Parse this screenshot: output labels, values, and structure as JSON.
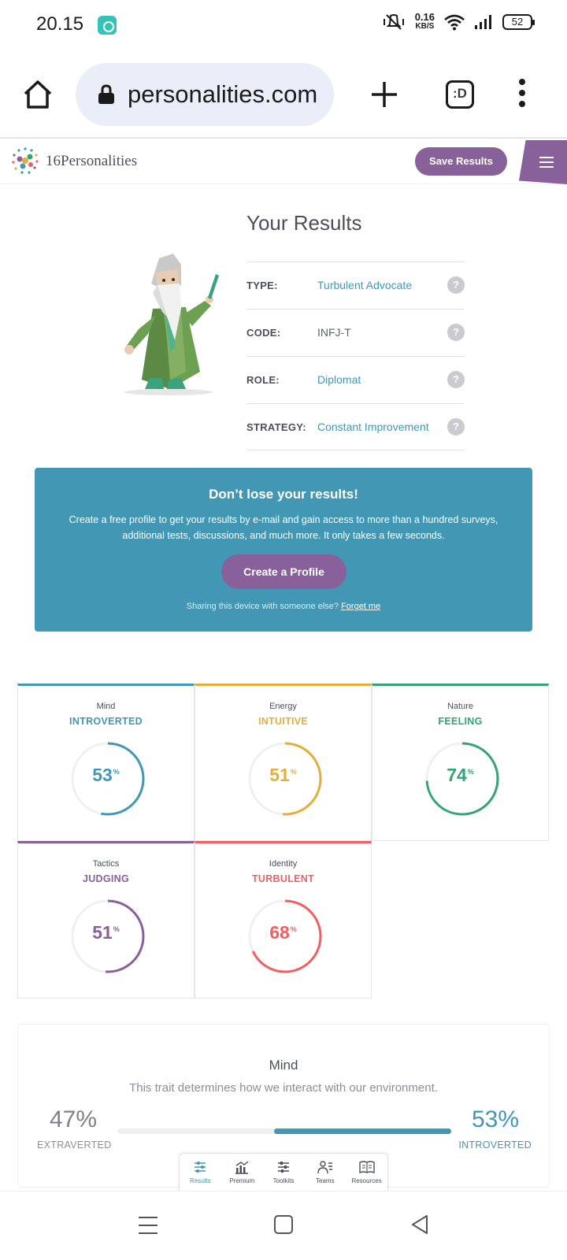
{
  "status_bar": {
    "time": "20.15",
    "network_speed_value": "0.16",
    "network_speed_unit": "KB/S",
    "battery": "52"
  },
  "browser": {
    "url": "personalities.com",
    "tabs_label": ":D"
  },
  "header": {
    "logo_text": "16Personalities",
    "save_label": "Save Results"
  },
  "results": {
    "title": "Your Results",
    "rows": [
      {
        "label": "TYPE:",
        "value": "Turbulent Advocate",
        "help": "?"
      },
      {
        "label": "CODE:",
        "value": "INFJ-T",
        "help": "?"
      },
      {
        "label": "ROLE:",
        "value": "Diplomat",
        "help": "?"
      },
      {
        "label": "STRATEGY:",
        "value": "Constant Improvement",
        "help": "?"
      }
    ]
  },
  "cta": {
    "title": "Don’t lose your results!",
    "text": "Create a free profile to get your results by e-mail and gain access to more than a hundred surveys, additional tests, discussions, and much more. It only takes a few seconds.",
    "button": "Create a Profile",
    "footer_text": "Sharing this device with someone else?",
    "footer_link": "Forget me"
  },
  "traits": [
    {
      "category": "Mind",
      "name": "INTROVERTED",
      "percent": 53,
      "color": "#4298b4"
    },
    {
      "category": "Energy",
      "name": "INTUITIVE",
      "percent": 51,
      "color": "#e4ae3a"
    },
    {
      "category": "Nature",
      "name": "FEELING",
      "percent": 74,
      "color": "#33a474"
    },
    {
      "category": "Tactics",
      "name": "JUDGING",
      "percent": 51,
      "color": "#88619a"
    },
    {
      "category": "Identity",
      "name": "TURBULENT",
      "percent": 68,
      "color": "#f25e62"
    }
  ],
  "percent_sign": "%",
  "mind_detail": {
    "title": "Mind",
    "description": "This trait determines how we interact with our environment.",
    "left_percent": "47%",
    "left_label": "EXTRAVERTED",
    "right_percent": "53%",
    "right_label": "INTROVERTED",
    "fill_fraction": 0.53
  },
  "bottom_nav": [
    {
      "label": "Results",
      "icon": "results-icon"
    },
    {
      "label": "Premium",
      "icon": "premium-icon"
    },
    {
      "label": "Toolkits",
      "icon": "toolkits-icon"
    },
    {
      "label": "Teams",
      "icon": "teams-icon"
    },
    {
      "label": "Resources",
      "icon": "resources-icon"
    }
  ]
}
